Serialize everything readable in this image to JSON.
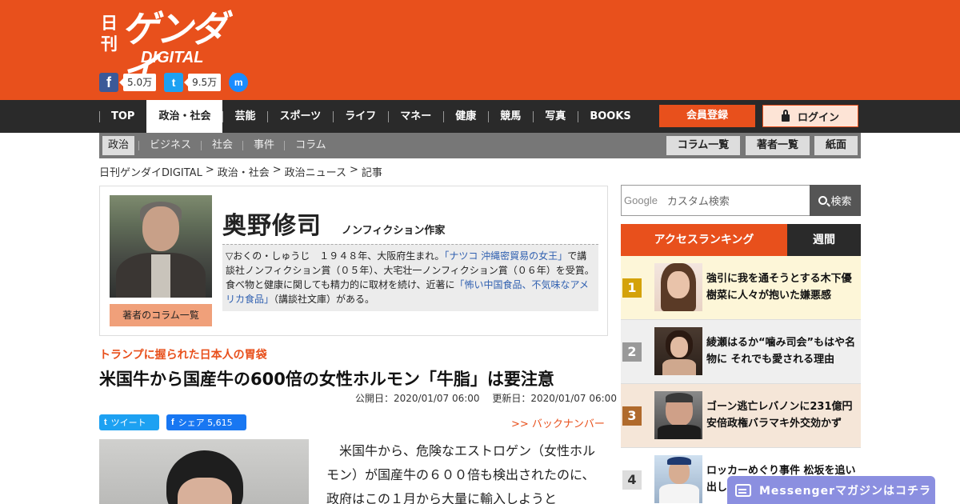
{
  "logo": {
    "kanji": "日刊",
    "main": "ゲンダイ",
    "sub": "DIGITAL"
  },
  "social": {
    "facebook_glyph": "f",
    "facebook_count": "5.0万",
    "twitter_glyph": "t",
    "twitter_count": "9.5万",
    "messenger_glyph": "m"
  },
  "nav": {
    "items": [
      "TOP",
      "政治・社会",
      "芸能",
      "スポーツ",
      "ライフ",
      "マネー",
      "健康",
      "競馬",
      "写真",
      "BOOKS"
    ],
    "active": "政治・社会",
    "register": "会員登録",
    "login": "ログイン"
  },
  "subnav": {
    "items": [
      "政治",
      "ビジネス",
      "社会",
      "事件",
      "コラム"
    ],
    "active": "政治",
    "buttons": [
      "コラム一覧",
      "著者一覧",
      "紙面"
    ]
  },
  "breadcrumb": [
    "日刊ゲンダイDIGITAL",
    "政治・社会",
    "政治ニュース",
    "記事"
  ],
  "breadcrumb_sep": ">",
  "author": {
    "name": "奥野修司",
    "title": "ノンフィクション作家",
    "link": "著者のコラム一覧",
    "bio_1": "▽おくの・しゅうじ　１９４８年、大阪府生まれ。",
    "bio_link_1": "「ナツコ 沖縄密貿易の女王」",
    "bio_2": "で講談社ノンフィクション賞（０５年）、大宅壮一ノンフィクション賞（０６年）を受賞。食べ物と健康に関しても精力的に取材を続け、近著に",
    "bio_link_2": "「怖い中国食品、不気味なアメリカ食品」",
    "bio_3": "（講談社文庫）がある。"
  },
  "article": {
    "kicker": "トランプに握られた日本人の胃袋",
    "headline": "米国牛から国産牛の600倍の女性ホルモン「牛脂」は要注意",
    "published": "公開日：2020/01/07 06:00",
    "updated": "更新日：2020/01/07 06:00",
    "tweet_icon": "t",
    "tweet": "ツイート",
    "share_icon": "f",
    "share": "シェア 5,615",
    "backnumber": ">> バックナンバー",
    "body": "米国牛から、危険なエストロゲン（女性ホルモン）が国産牛の６００倍も検出されたのに、政府はこの１月から大量に輸入しようと"
  },
  "search": {
    "google": "Google",
    "placeholder": "カスタム検索",
    "button": "検索"
  },
  "ranking": {
    "tab_access": "アクセスランキング",
    "tab_weekly": "週間",
    "items": [
      {
        "rank": "1",
        "text": "強引に我を通そうとする木下優樹菜に人々が抱いた嫌悪感"
      },
      {
        "rank": "2",
        "text": "綾瀬はるか“噛み司会”もはや名物に それでも愛される理由"
      },
      {
        "rank": "3",
        "text": "ゴーン逃亡レバノンに231億円 安倍政権バラマキ外交効かず"
      },
      {
        "rank": "4",
        "text": "ロッカーめぐり事件 松坂を追い出し"
      }
    ]
  },
  "messenger": "Messengerマガジンはコチラ"
}
